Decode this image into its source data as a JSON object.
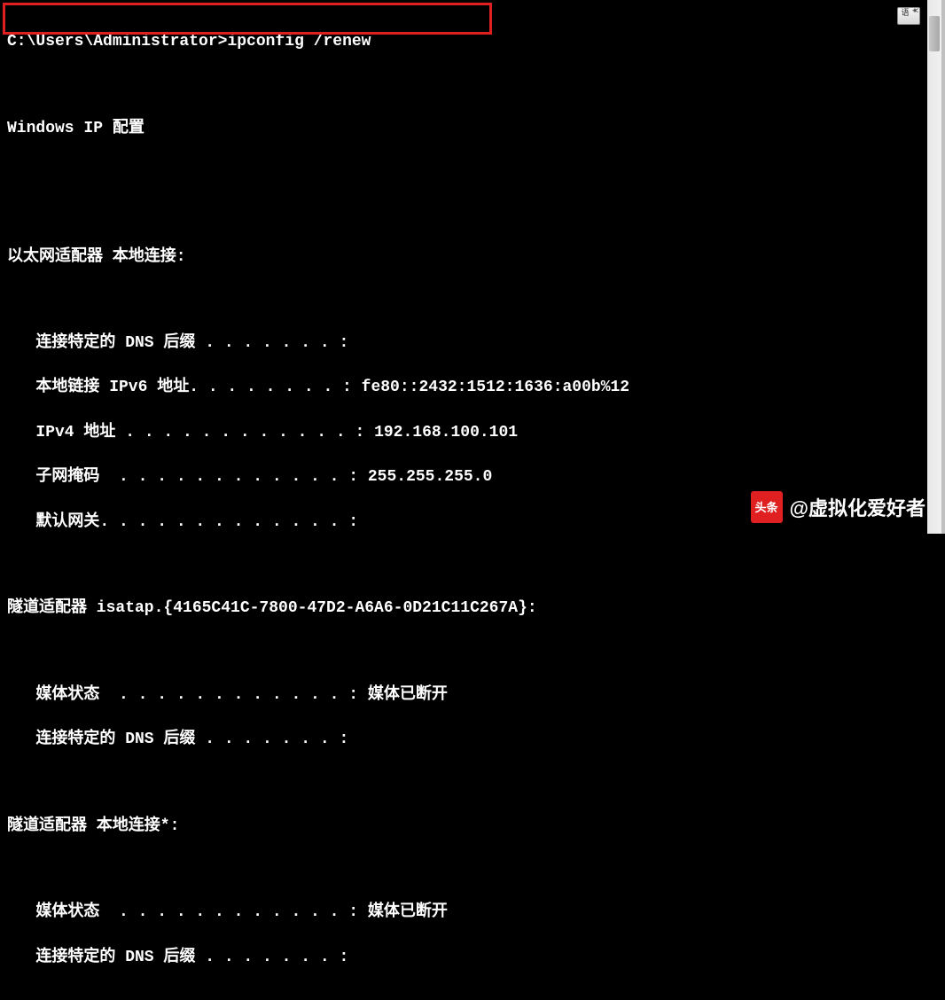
{
  "command": {
    "prompt": "C:\\Users\\Administrator>",
    "text": "ipconfig /renew"
  },
  "header": "Windows IP 配置",
  "adapter1": {
    "title": "以太网适配器 本地连接:",
    "dns_suffix_label": "   连接特定的 DNS 后缀 . . . . . . . :",
    "dns_suffix_value": "",
    "ipv6_label": "   本地链接 IPv6 地址. . . . . . . . : ",
    "ipv6_value": "fe80::2432:1512:1636:a00b%12",
    "ipv4_label": "   IPv4 地址 . . . . . . . . . . . . : ",
    "ipv4_value": "192.168.100.101",
    "subnet_label": "   子网掩码  . . . . . . . . . . . . : ",
    "subnet_value": "255.255.255.0",
    "gateway_label": "   默认网关. . . . . . . . . . . . . :",
    "gateway_value": ""
  },
  "adapter2": {
    "title": "隧道适配器 isatap.{4165C41C-7800-47D2-A6A6-0D21C11C267A}:",
    "media_label": "   媒体状态  . . . . . . . . . . . . : ",
    "media_value": "媒体已断开",
    "dns_suffix_label": "   连接特定的 DNS 后缀 . . . . . . . :",
    "dns_suffix_value": ""
  },
  "adapter3": {
    "title": "隧道适配器 本地连接*:",
    "media_label": "   媒体状态  . . . . . . . . . . . . : ",
    "media_value": "媒体已断开",
    "dns_suffix_label": "   连接特定的 DNS 后缀 . . . . . . . :",
    "dns_suffix_value": ""
  },
  "watermark": {
    "logo_text": "头条",
    "text": "@虚拟化爱好者"
  },
  "title_btn": "¥ 语"
}
